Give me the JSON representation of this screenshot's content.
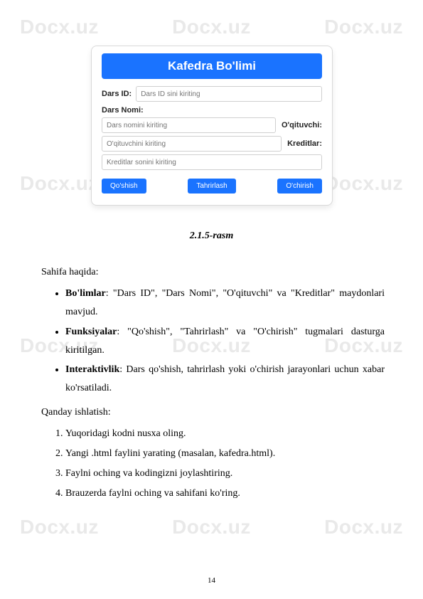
{
  "watermark": "Docx.uz",
  "panel": {
    "title": "Kafedra Bo'limi",
    "dars_id_label": "Dars ID:",
    "dars_id_placeholder": "Dars ID sini kiriting",
    "dars_nomi_label": "Dars Nomi:",
    "dars_nomi_placeholder": "Dars nomini kiriting",
    "oqituvchi_label": "O'qituvchi:",
    "oqituvchi_placeholder": "O'qituvchini kiriting",
    "kreditlar_label": "Kreditlar:",
    "kreditlar_placeholder": "Kreditlar sonini kiriting",
    "btn_add": "Qo'shish",
    "btn_edit": "Tahrirlash",
    "btn_delete": "O'chirish"
  },
  "caption": "2.1.5-rasm",
  "section1_heading": "Sahifa haqida:",
  "bullets": [
    {
      "bold": "Bo'limlar",
      "text": ": \"Dars ID\", \"Dars Nomi\", \"O'qituvchi\" va \"Kreditlar\" maydonlari mavjud."
    },
    {
      "bold": "Funksiyalar",
      "text": ": \"Qo'shish\", \"Tahrirlash\" va \"O'chirish\" tugmalari dasturga kiritilgan."
    },
    {
      "bold": "Interaktivlik",
      "text": ": Dars qo'shish, tahrirlash yoki o'chirish jarayonlari uchun xabar ko'rsatiladi."
    }
  ],
  "section2_heading": "Qanday ishlatish:",
  "steps": [
    "Yuqoridagi kodni nusxa oling.",
    "Yangi .html faylini yarating (masalan, kafedra.html).",
    "Faylni oching va kodingizni joylashtiring.",
    "Brauzerda faylni oching va sahifani ko'ring."
  ],
  "page_number": "14"
}
